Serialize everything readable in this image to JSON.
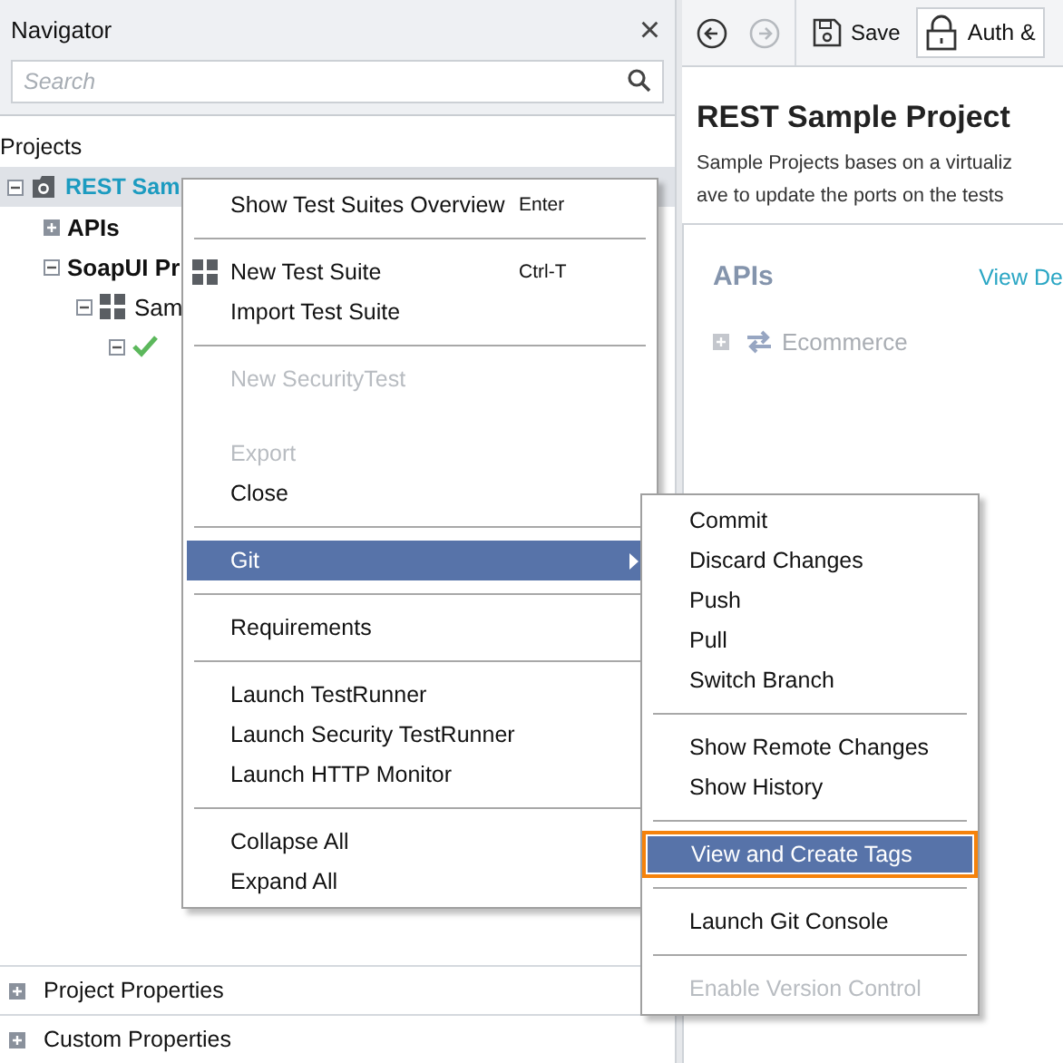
{
  "navigator": {
    "title": "Navigator",
    "close": "×",
    "search": {
      "placeholder": "Search"
    },
    "section": "Projects",
    "tree": [
      {
        "label": "REST Sam",
        "kind": "project",
        "selected": true,
        "expanded": true,
        "children": [
          {
            "label": "APIs",
            "kind": "folder",
            "selected": false,
            "expanded": false
          },
          {
            "label": "SoapUI Pr",
            "kind": "folder",
            "selected": false,
            "expanded": true,
            "children": [
              {
                "label": "Sam",
                "kind": "suite",
                "selected": false,
                "expanded": true,
                "children": [
                  {
                    "kind": "case",
                    "selected": false,
                    "expanded": true
                  }
                ]
              }
            ]
          }
        ]
      }
    ],
    "properties": [
      {
        "label": "Project Properties",
        "expanded": false
      },
      {
        "label": "Custom Properties",
        "expanded": false
      }
    ]
  },
  "editor": {
    "toolbar": {
      "save": "Save",
      "auth": "Auth &"
    },
    "title": "REST Sample Project",
    "description": [
      "Sample Projects bases on a virtualiz",
      "ave to update the ports on the tests"
    ],
    "apis": {
      "heading": "APIs",
      "link": "View De",
      "items": [
        {
          "label": "Ecommerce",
          "expanded": false
        }
      ]
    }
  },
  "menu": {
    "items": [
      {
        "kind": "item",
        "label": "Show Test Suites Overview",
        "shortcut": "Enter",
        "disabled": false,
        "selected": false
      },
      {
        "kind": "separator"
      },
      {
        "kind": "icon_item",
        "label": "New Test Suite",
        "shortcut": "Ctrl-T",
        "disabled": false,
        "selected": false
      },
      {
        "kind": "item",
        "label": "Import Test Suite",
        "disabled": false,
        "selected": false
      },
      {
        "kind": "separator"
      },
      {
        "kind": "item",
        "label": "New SecurityTest",
        "disabled": true,
        "selected": false
      },
      {
        "kind": "gap"
      },
      {
        "kind": "item",
        "label": "Export",
        "disabled": true,
        "selected": false
      },
      {
        "kind": "item",
        "label": "Close",
        "disabled": false,
        "selected": false
      },
      {
        "kind": "separator"
      },
      {
        "kind": "submenu",
        "label": "Git",
        "disabled": false,
        "selected": true
      },
      {
        "kind": "separator"
      },
      {
        "kind": "item",
        "label": "Requirements",
        "disabled": false,
        "selected": false
      },
      {
        "kind": "separator"
      },
      {
        "kind": "item",
        "label": "Launch TestRunner",
        "disabled": false,
        "selected": false
      },
      {
        "kind": "item",
        "label": "Launch Security TestRunner",
        "disabled": false,
        "selected": false
      },
      {
        "kind": "item",
        "label": "Launch HTTP Monitor",
        "disabled": false,
        "selected": false
      },
      {
        "kind": "separator"
      },
      {
        "kind": "item",
        "label": "Collapse All",
        "disabled": false,
        "selected": false
      },
      {
        "kind": "item",
        "label": "Expand All",
        "disabled": false,
        "selected": false
      }
    ]
  },
  "git_menu": {
    "items": [
      {
        "kind": "item",
        "label": "Commit",
        "disabled": false,
        "selected": false
      },
      {
        "kind": "item",
        "label": "Discard Changes",
        "disabled": false,
        "selected": false
      },
      {
        "kind": "item",
        "label": "Push",
        "disabled": false,
        "selected": false
      },
      {
        "kind": "item",
        "label": "Pull",
        "disabled": false,
        "selected": false
      },
      {
        "kind": "item",
        "label": "Switch Branch",
        "disabled": false,
        "selected": false
      },
      {
        "kind": "separator"
      },
      {
        "kind": "item",
        "label": "Show Remote Changes",
        "disabled": false,
        "selected": false
      },
      {
        "kind": "item",
        "label": "Show History",
        "disabled": false,
        "selected": false
      },
      {
        "kind": "separator"
      },
      {
        "kind": "item",
        "label": "View and Create Tags",
        "disabled": false,
        "selected": true
      },
      {
        "kind": "separator"
      },
      {
        "kind": "item",
        "label": "Launch Git Console",
        "disabled": false,
        "selected": false
      },
      {
        "kind": "separator"
      },
      {
        "kind": "item",
        "label": "Enable Version Control",
        "disabled": true,
        "selected": false
      }
    ]
  }
}
